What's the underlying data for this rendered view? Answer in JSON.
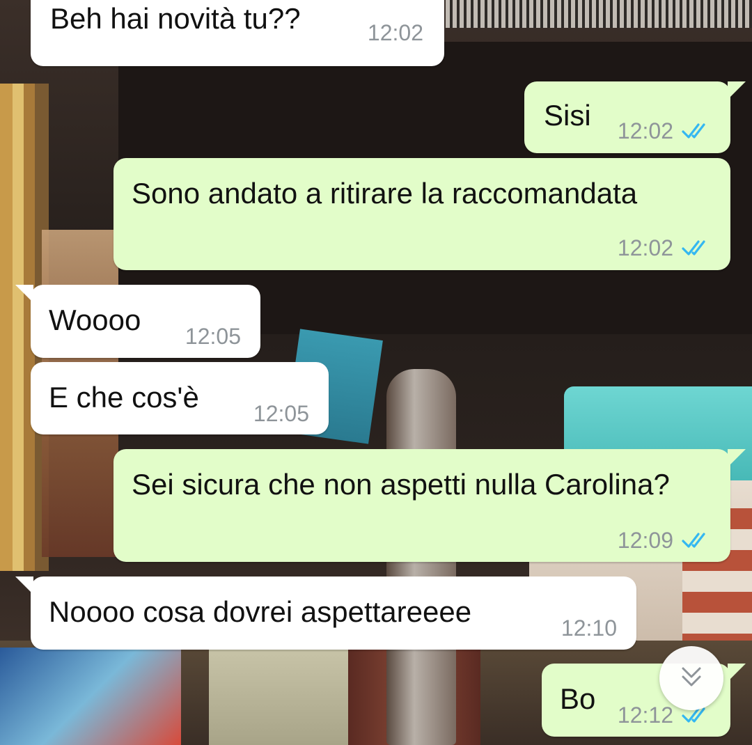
{
  "app": "WhatsApp",
  "colors": {
    "incoming_bubble": "#ffffff",
    "outgoing_bubble": "#e2fdc9",
    "timestamp": "#8e9499",
    "read_ticks": "#34b7f1"
  },
  "messages": [
    {
      "direction": "in",
      "text": "Beh hai novità tu??",
      "time": "12:02"
    },
    {
      "direction": "out",
      "text": "Sisi",
      "time": "12:02",
      "status": "read"
    },
    {
      "direction": "out",
      "text": "Sono andato a ritirare la raccomandata",
      "time": "12:02",
      "status": "read"
    },
    {
      "direction": "in",
      "text": "Woooo",
      "time": "12:05"
    },
    {
      "direction": "in",
      "text": "E che cos'è",
      "time": "12:05"
    },
    {
      "direction": "out",
      "text": "Sei sicura che non aspetti nulla Carolina?",
      "time": "12:09",
      "status": "read"
    },
    {
      "direction": "in",
      "text": "Noooo cosa dovrei aspettareeee",
      "time": "12:10"
    },
    {
      "direction": "out",
      "text": "Bo",
      "time": "12:12",
      "status": "read"
    }
  ],
  "scroll_button": {
    "icon": "double-chevron-down-icon"
  }
}
